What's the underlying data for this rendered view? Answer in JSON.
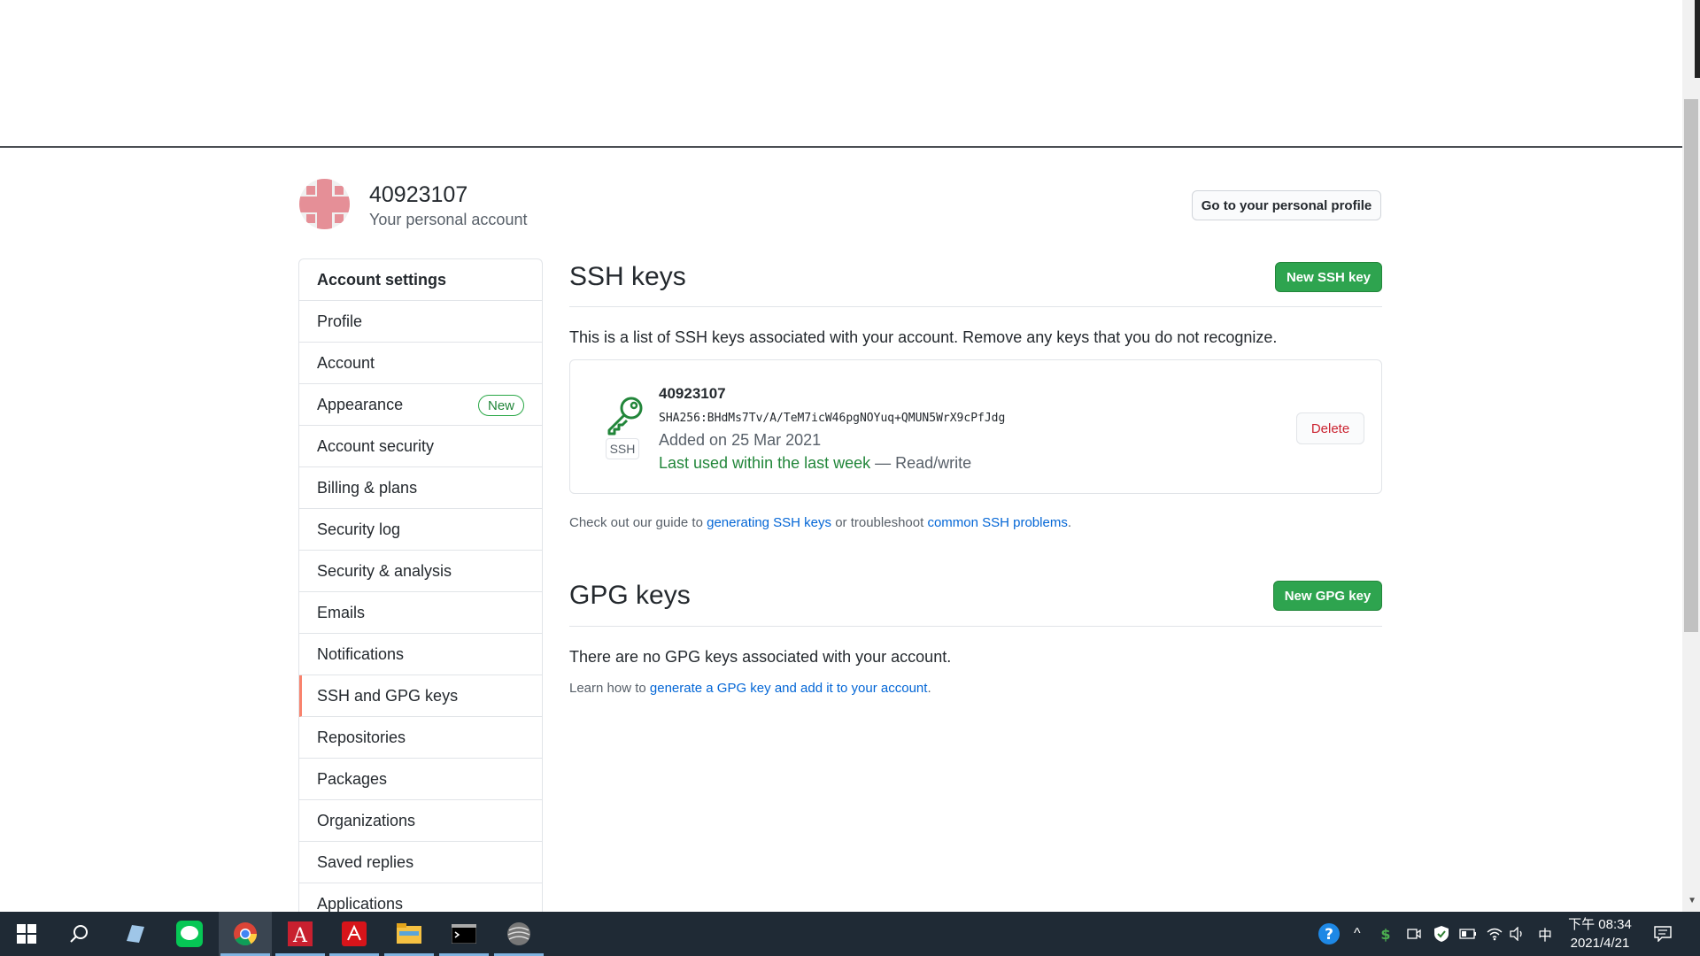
{
  "account": {
    "username": "40923107",
    "subtitle": "Your personal account",
    "profile_button": "Go to your personal profile"
  },
  "sidebar": {
    "header": "Account settings",
    "items": [
      {
        "label": "Profile"
      },
      {
        "label": "Account"
      },
      {
        "label": "Appearance",
        "badge": "New"
      },
      {
        "label": "Account security"
      },
      {
        "label": "Billing & plans"
      },
      {
        "label": "Security log"
      },
      {
        "label": "Security & analysis"
      },
      {
        "label": "Emails"
      },
      {
        "label": "Notifications"
      },
      {
        "label": "SSH and GPG keys",
        "active": true
      },
      {
        "label": "Repositories"
      },
      {
        "label": "Packages"
      },
      {
        "label": "Organizations"
      },
      {
        "label": "Saved replies"
      },
      {
        "label": "Applications"
      }
    ]
  },
  "ssh": {
    "title": "SSH keys",
    "new_button": "New SSH key",
    "description": "This is a list of SSH keys associated with your account. Remove any keys that you do not recognize.",
    "key": {
      "title": "40923107",
      "fingerprint": "SHA256:BHdMs7Tv/A/TeM7icW46pgNOYuq+QMUN5WrX9cPfJdg",
      "added": "Added on 25 Mar 2021",
      "last_used": "Last used within the last week",
      "access": " — Read/write",
      "type_label": "SSH",
      "delete_button": "Delete"
    },
    "guide_prefix": "Check out our guide to ",
    "guide_link1": "generating SSH keys",
    "guide_mid": " or troubleshoot ",
    "guide_link2": "common SSH problems",
    "guide_suffix": "."
  },
  "gpg": {
    "title": "GPG keys",
    "new_button": "New GPG key",
    "empty": "There are no GPG keys associated with your account.",
    "learn_prefix": "Learn how to ",
    "learn_link": "generate a GPG key and add it to your account",
    "learn_suffix": "."
  },
  "taskbar": {
    "clock_period_time": "下午 08:34",
    "clock_date": "2021/4/21",
    "ime": "中",
    "apps": [
      "start-icon",
      "search-icon",
      "taskview-icon",
      "line-icon",
      "chrome-icon",
      "autocad-icon",
      "acrobat-icon",
      "file-explorer-icon",
      "terminal-icon",
      "app-icon"
    ]
  },
  "colors": {
    "green_button": "#2ea44f",
    "link": "#0366d6",
    "active_border": "#f9826c",
    "danger": "#cb2431"
  }
}
